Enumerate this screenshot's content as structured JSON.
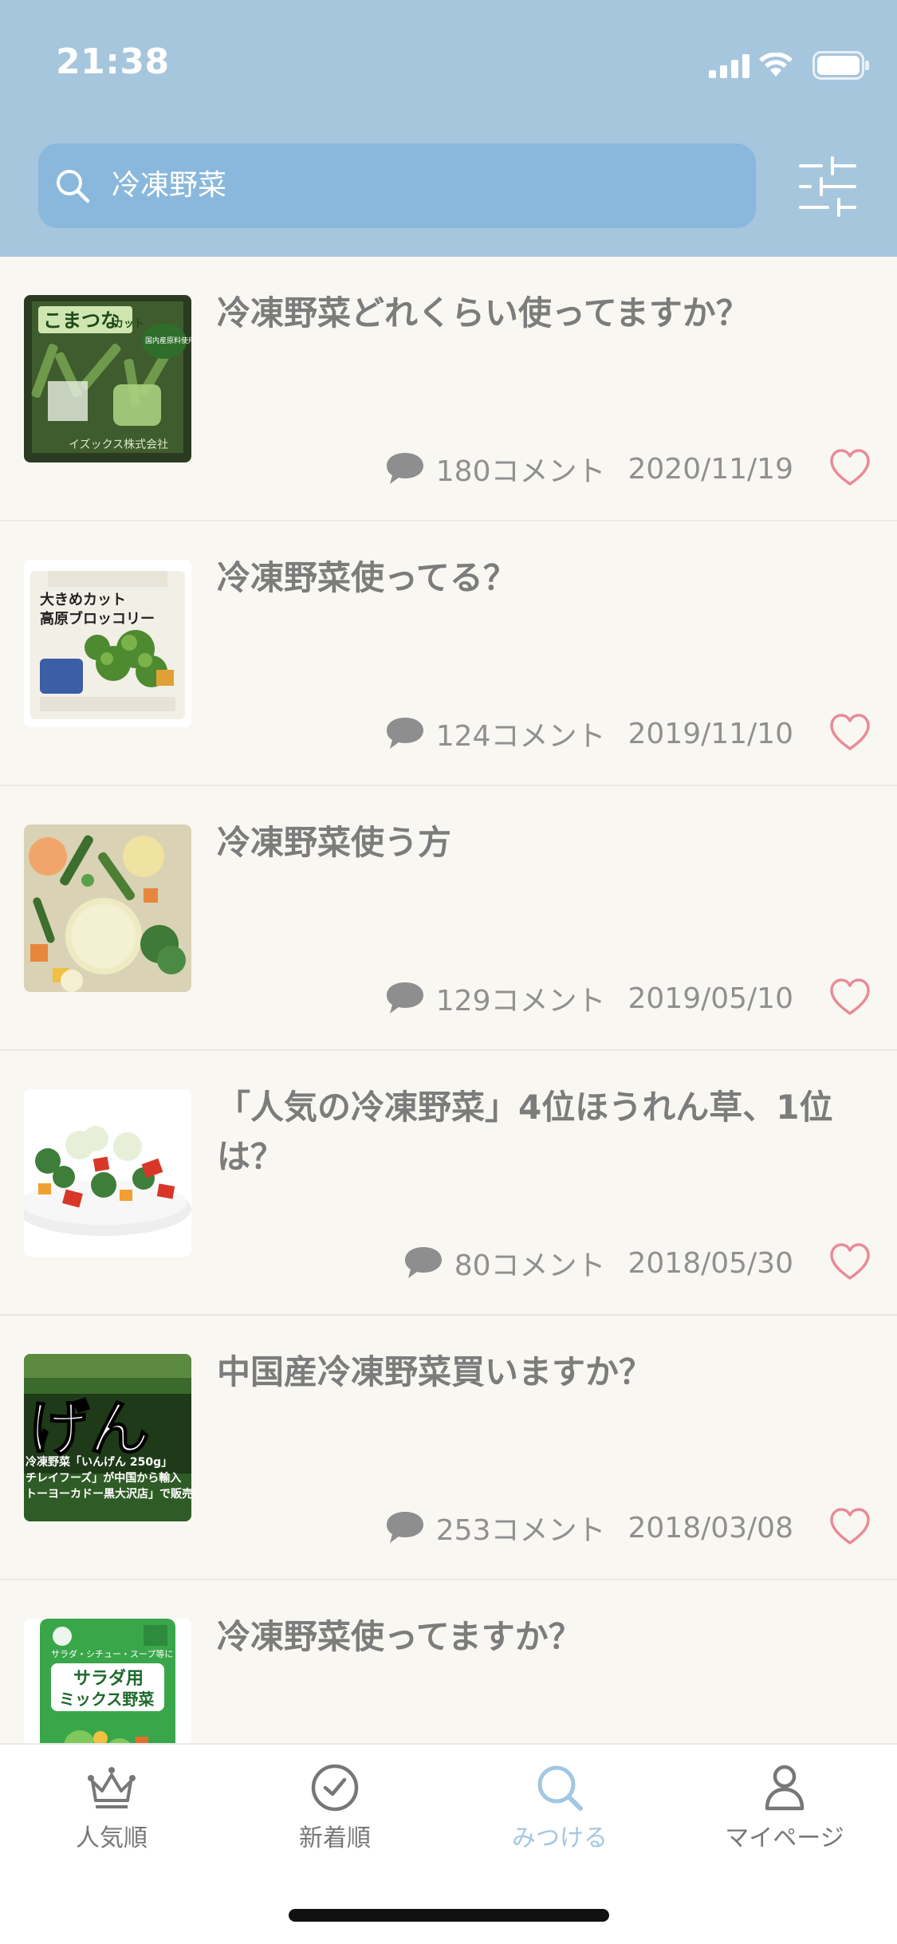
{
  "status_bar": {
    "time": "21:38"
  },
  "search": {
    "value": "冷凍野菜"
  },
  "colors": {
    "header_bg": "#a6c6dd",
    "search_bg": "#8ab8dc",
    "accent": "#a2c7e3",
    "heart": "#e98a98",
    "background": "#f9f7f2"
  },
  "results": [
    {
      "title": "冷凍野菜どれくらい使ってますか？",
      "comments": "180コメント",
      "date": "2020/11/19"
    },
    {
      "title": "冷凍野菜使ってる？",
      "comments": "124コメント",
      "date": "2019/11/10"
    },
    {
      "title": "冷凍野菜使う方",
      "comments": "129コメント",
      "date": "2019/05/10"
    },
    {
      "title": "「人気の冷凍野菜」4位ほうれん草、1位は？",
      "comments": "80コメント",
      "date": "2018/05/30"
    },
    {
      "title": "中国産冷凍野菜買いますか？",
      "comments": "253コメント",
      "date": "2018/03/08"
    },
    {
      "title": "冷凍野菜使ってますか？",
      "comments": "",
      "date": ""
    }
  ],
  "thumb_text": {
    "t1": {
      "brand": "こまつな",
      "brand_small": "カット",
      "badge": "国内産原料使用",
      "maker": "イズックス株式会社"
    },
    "t2": {
      "line1": "大きめカット",
      "line2": "高原ブロッコリー"
    },
    "t5": {
      "big": "げん",
      "l1": "冷凍野菜「いんげん 250g」",
      "l2": "チレイフーズ」が中国から輸入",
      "l3": "トーヨーカドー黒大沢店」で販売"
    },
    "t6": {
      "top": "サラダ・シチュー・スープ等に",
      "l1": "サラダ用",
      "l2": "ミックス野菜"
    }
  },
  "icons": {
    "search": "search-icon",
    "filter": "sliders-icon",
    "comment": "speech-bubble-icon",
    "like": "heart-icon",
    "popular": "crown-icon",
    "newest": "clock-icon",
    "discover": "search-icon",
    "mypage": "person-icon"
  },
  "tabs": [
    {
      "label": "人気順",
      "active": false
    },
    {
      "label": "新着順",
      "active": false
    },
    {
      "label": "みつける",
      "active": true
    },
    {
      "label": "マイページ",
      "active": false
    }
  ]
}
